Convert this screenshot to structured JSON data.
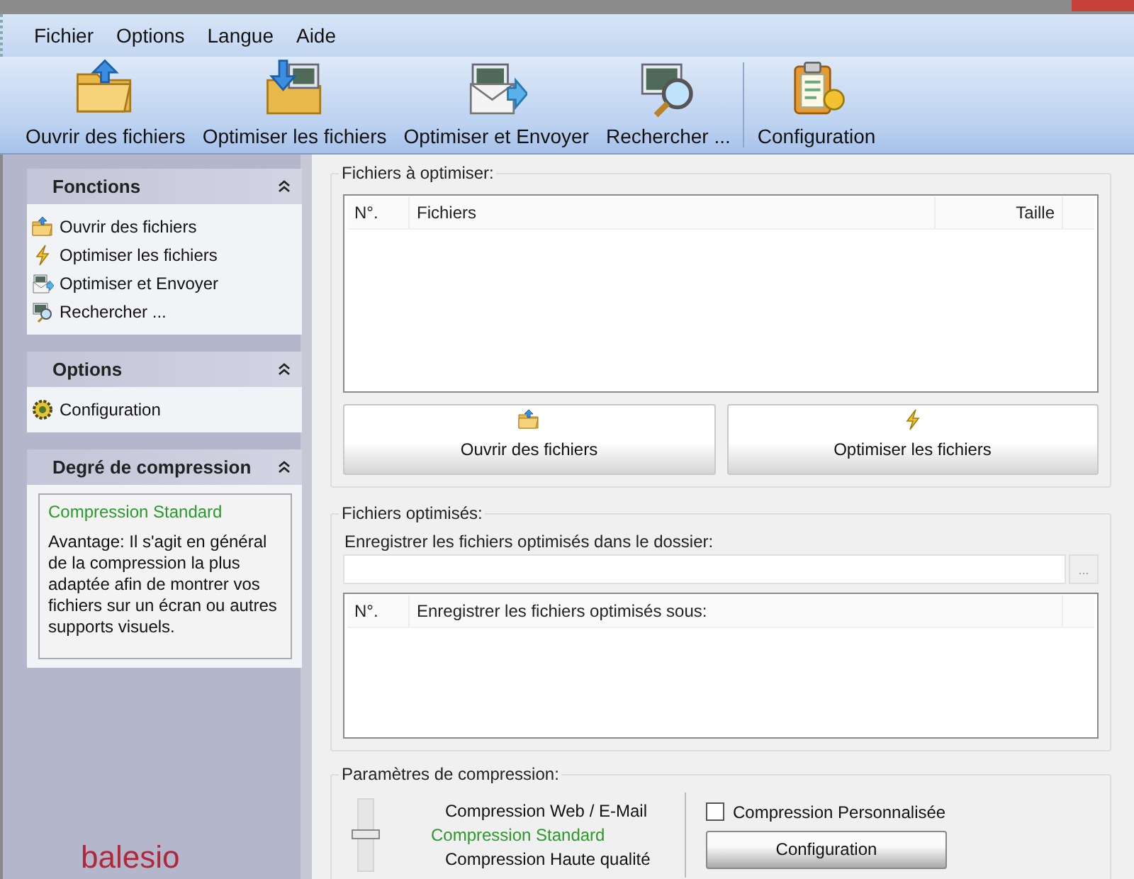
{
  "menu": [
    {
      "label": "Fichier"
    },
    {
      "label": "Options"
    },
    {
      "label": "Langue"
    },
    {
      "label": "Aide"
    }
  ],
  "toolbar": [
    {
      "label": "Ouvrir des fichiers"
    },
    {
      "label": "Optimiser les fichiers"
    },
    {
      "label": "Optimiser et Envoyer"
    },
    {
      "label": "Rechercher ..."
    },
    {
      "label": "Configuration"
    }
  ],
  "sidebar": {
    "panels": [
      {
        "title": "Fonctions",
        "expanded": true,
        "kind": "links",
        "items": [
          {
            "label": "Ouvrir des fichiers"
          },
          {
            "label": "Optimiser les fichiers"
          },
          {
            "label": "Optimiser et Envoyer"
          },
          {
            "label": "Rechercher ..."
          }
        ]
      },
      {
        "title": "Options",
        "expanded": true,
        "kind": "links",
        "items": [
          {
            "label": "Configuration"
          }
        ]
      },
      {
        "title": "Degré de compression",
        "expanded": true,
        "kind": "info",
        "heading": "Compression Standard",
        "text": "Avantage: Il s'agit en général de la compression la plus adaptée afin de montrer vos fichiers sur un écran ou autres supports visuels."
      }
    ],
    "logo": "balesio"
  },
  "files_to_optimize": {
    "title": "Fichiers à optimiser:",
    "columns": [
      "N°.",
      "Fichiers",
      "Taille"
    ],
    "buttons": [
      {
        "label": "Ouvrir des fichiers"
      },
      {
        "label": "Optimiser les fichiers"
      }
    ]
  },
  "optimized_files": {
    "title": "Fichiers optimisés:",
    "folder_label": "Enregistrer les fichiers optimisés dans le dossier:",
    "browse_button": "...",
    "columns": [
      "N°.",
      "Enregistrer les fichiers optimisés sous:"
    ]
  },
  "compression": {
    "title": "Paramètres de compression:",
    "slider": {
      "level": 0.5
    },
    "options": [
      {
        "label": "Compression Web / E-Mail",
        "selected": false
      },
      {
        "label": "Compression Standard",
        "selected": true
      },
      {
        "label": "Compression Haute qualité",
        "selected": false
      }
    ],
    "custom": {
      "label": "Compression Personnalisée",
      "checked": false
    },
    "config_button": "Configuration"
  }
}
